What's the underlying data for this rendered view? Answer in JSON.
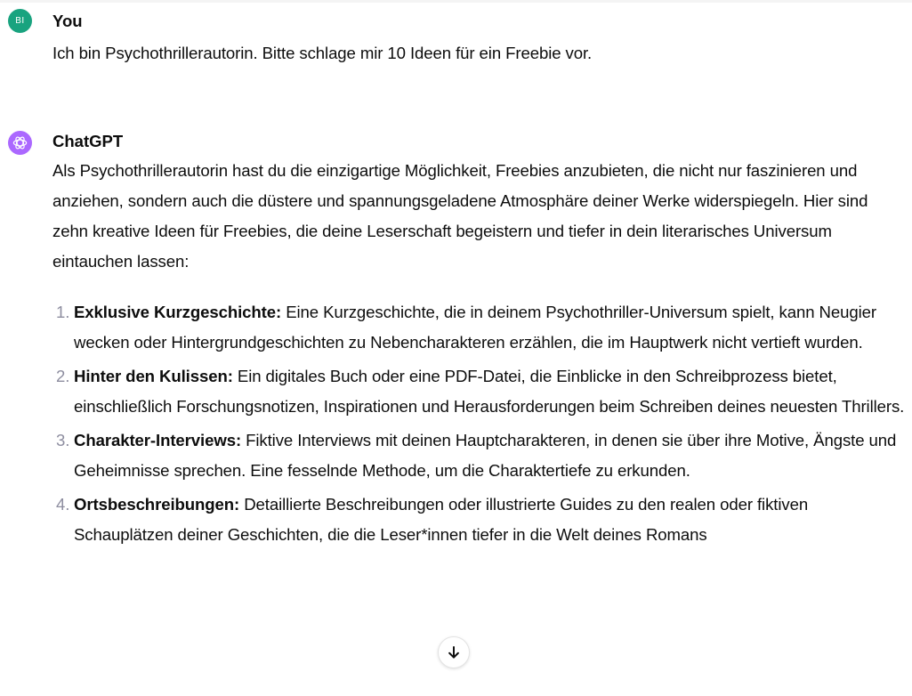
{
  "user_message": {
    "avatar_initials": "BI",
    "author": "You",
    "text": "Ich bin Psychothrillerautorin. Bitte schlage mir 10 Ideen für ein Freebie vor."
  },
  "assistant_message": {
    "avatar_icon": "openai-logo-icon",
    "author": "ChatGPT",
    "intro": "Als Psychothrillerautorin hast du die einzigartige Möglichkeit, Freebies anzubieten, die nicht nur faszinieren und anziehen, sondern auch die düstere und spannungsgeladene Atmosphäre deiner Werke widerspiegeln. Hier sind zehn kreative Ideen für Freebies, die deine Leserschaft begeistern und tiefer in dein literarisches Universum eintauchen lassen:",
    "items": [
      {
        "number": "1.",
        "term": "Exklusive Kurzgeschichte:",
        "text": "Eine Kurzgeschichte, die in deinem Psychothriller-Universum spielt, kann Neugier wecken oder Hintergrundgeschichten zu Nebencharakteren erzählen, die im Hauptwerk nicht vertieft wurden."
      },
      {
        "number": "2.",
        "term": "Hinter den Kulissen:",
        "text": "Ein digitales Buch oder eine PDF-Datei, die Einblicke in den Schreibprozess bietet, einschließlich Forschungsnotizen, Inspirationen und Herausforderungen beim Schreiben deines neuesten Thrillers."
      },
      {
        "number": "3.",
        "term": "Charakter-Interviews:",
        "text": "Fiktive Interviews mit deinen Hauptcharakteren, in denen sie über ihre Motive, Ängste und Geheimnisse sprechen. Eine fesselnde Methode, um die Charaktertiefe zu erkunden."
      },
      {
        "number": "4.",
        "term": "Ortsbeschreibungen:",
        "text": "Detaillierte Beschreibungen oder illustrierte Guides zu den realen oder fiktiven Schauplätzen deiner Geschichten, die die Leser*innen tiefer in die Welt deines Romans"
      }
    ]
  },
  "scroll_button": {
    "icon": "arrow-down-icon"
  },
  "colors": {
    "user_avatar": "#19a37f",
    "assistant_avatar": "#ab68ff",
    "list_number": "#8e8ea0",
    "text": "#0d0d0d"
  }
}
